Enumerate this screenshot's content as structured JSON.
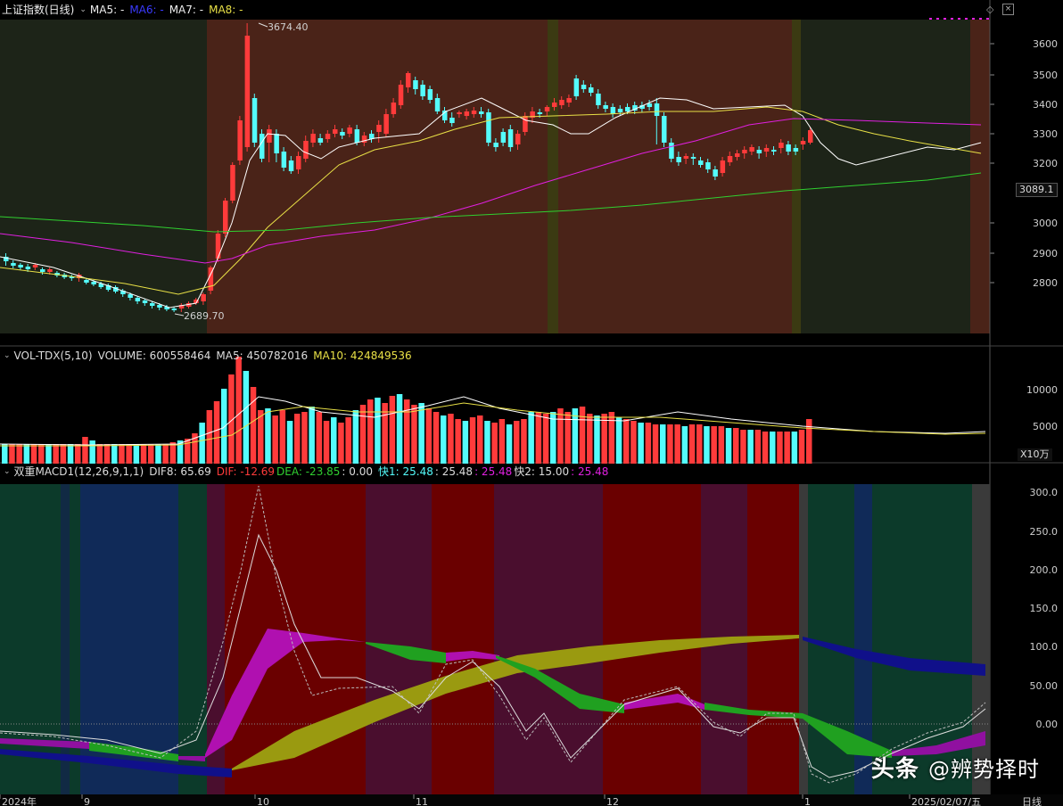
{
  "main_header": {
    "title": "上证指数(日线)",
    "ma5": "MA5: -",
    "ma6": "MA6: -",
    "ma7": "MA7: -",
    "ma8": "MA8: -"
  },
  "vol_header": {
    "name": "VOL-TDX(5,10)",
    "volume": "VOLUME: 600558464",
    "ma5": "MA5: 450782016",
    "ma10": "MA10: 424849536"
  },
  "macd_header": {
    "name": "双重MACD1(12,26,9,1,1)",
    "dif8": "DIF8: 65.69",
    "dif": "DIF: -12.69",
    "dea": "DEA: -23.85",
    "zero": ": 0.00",
    "k1a": "快1: 25.48",
    "k1b": ": 25.48",
    "k1c": ": 25.48",
    "k2": "快2: 15.00",
    "k2b": ": 25.48"
  },
  "price_axis": {
    "ticks": [
      "3600",
      "3500",
      "3400",
      "3300",
      "3200",
      "3000",
      "2900",
      "2800"
    ],
    "current": "3089.1",
    "high_label": "3674.40",
    "low_label": "2689.70"
  },
  "vol_axis": {
    "ticks": [
      "10000",
      "5000"
    ],
    "unit": "X10万"
  },
  "macd_axis": {
    "ticks": [
      "300.0",
      "250.0",
      "200.0",
      "150.0",
      "100.0",
      "50.00",
      "0.00"
    ]
  },
  "date_axis": {
    "labels": [
      "2024年",
      "9",
      "10",
      "11",
      "12",
      "1",
      "2025/02/07/五"
    ],
    "period": "日线"
  },
  "watermark": {
    "brand": "头条",
    "handle": "@辨势择时"
  },
  "colors": {
    "up": "#ff3b3b",
    "down": "#54fcfc",
    "ma_white": "#ffffff",
    "ma_yellow": "#e8e046",
    "ma_magenta": "#e020e0",
    "ma_green": "#30d030"
  }
}
